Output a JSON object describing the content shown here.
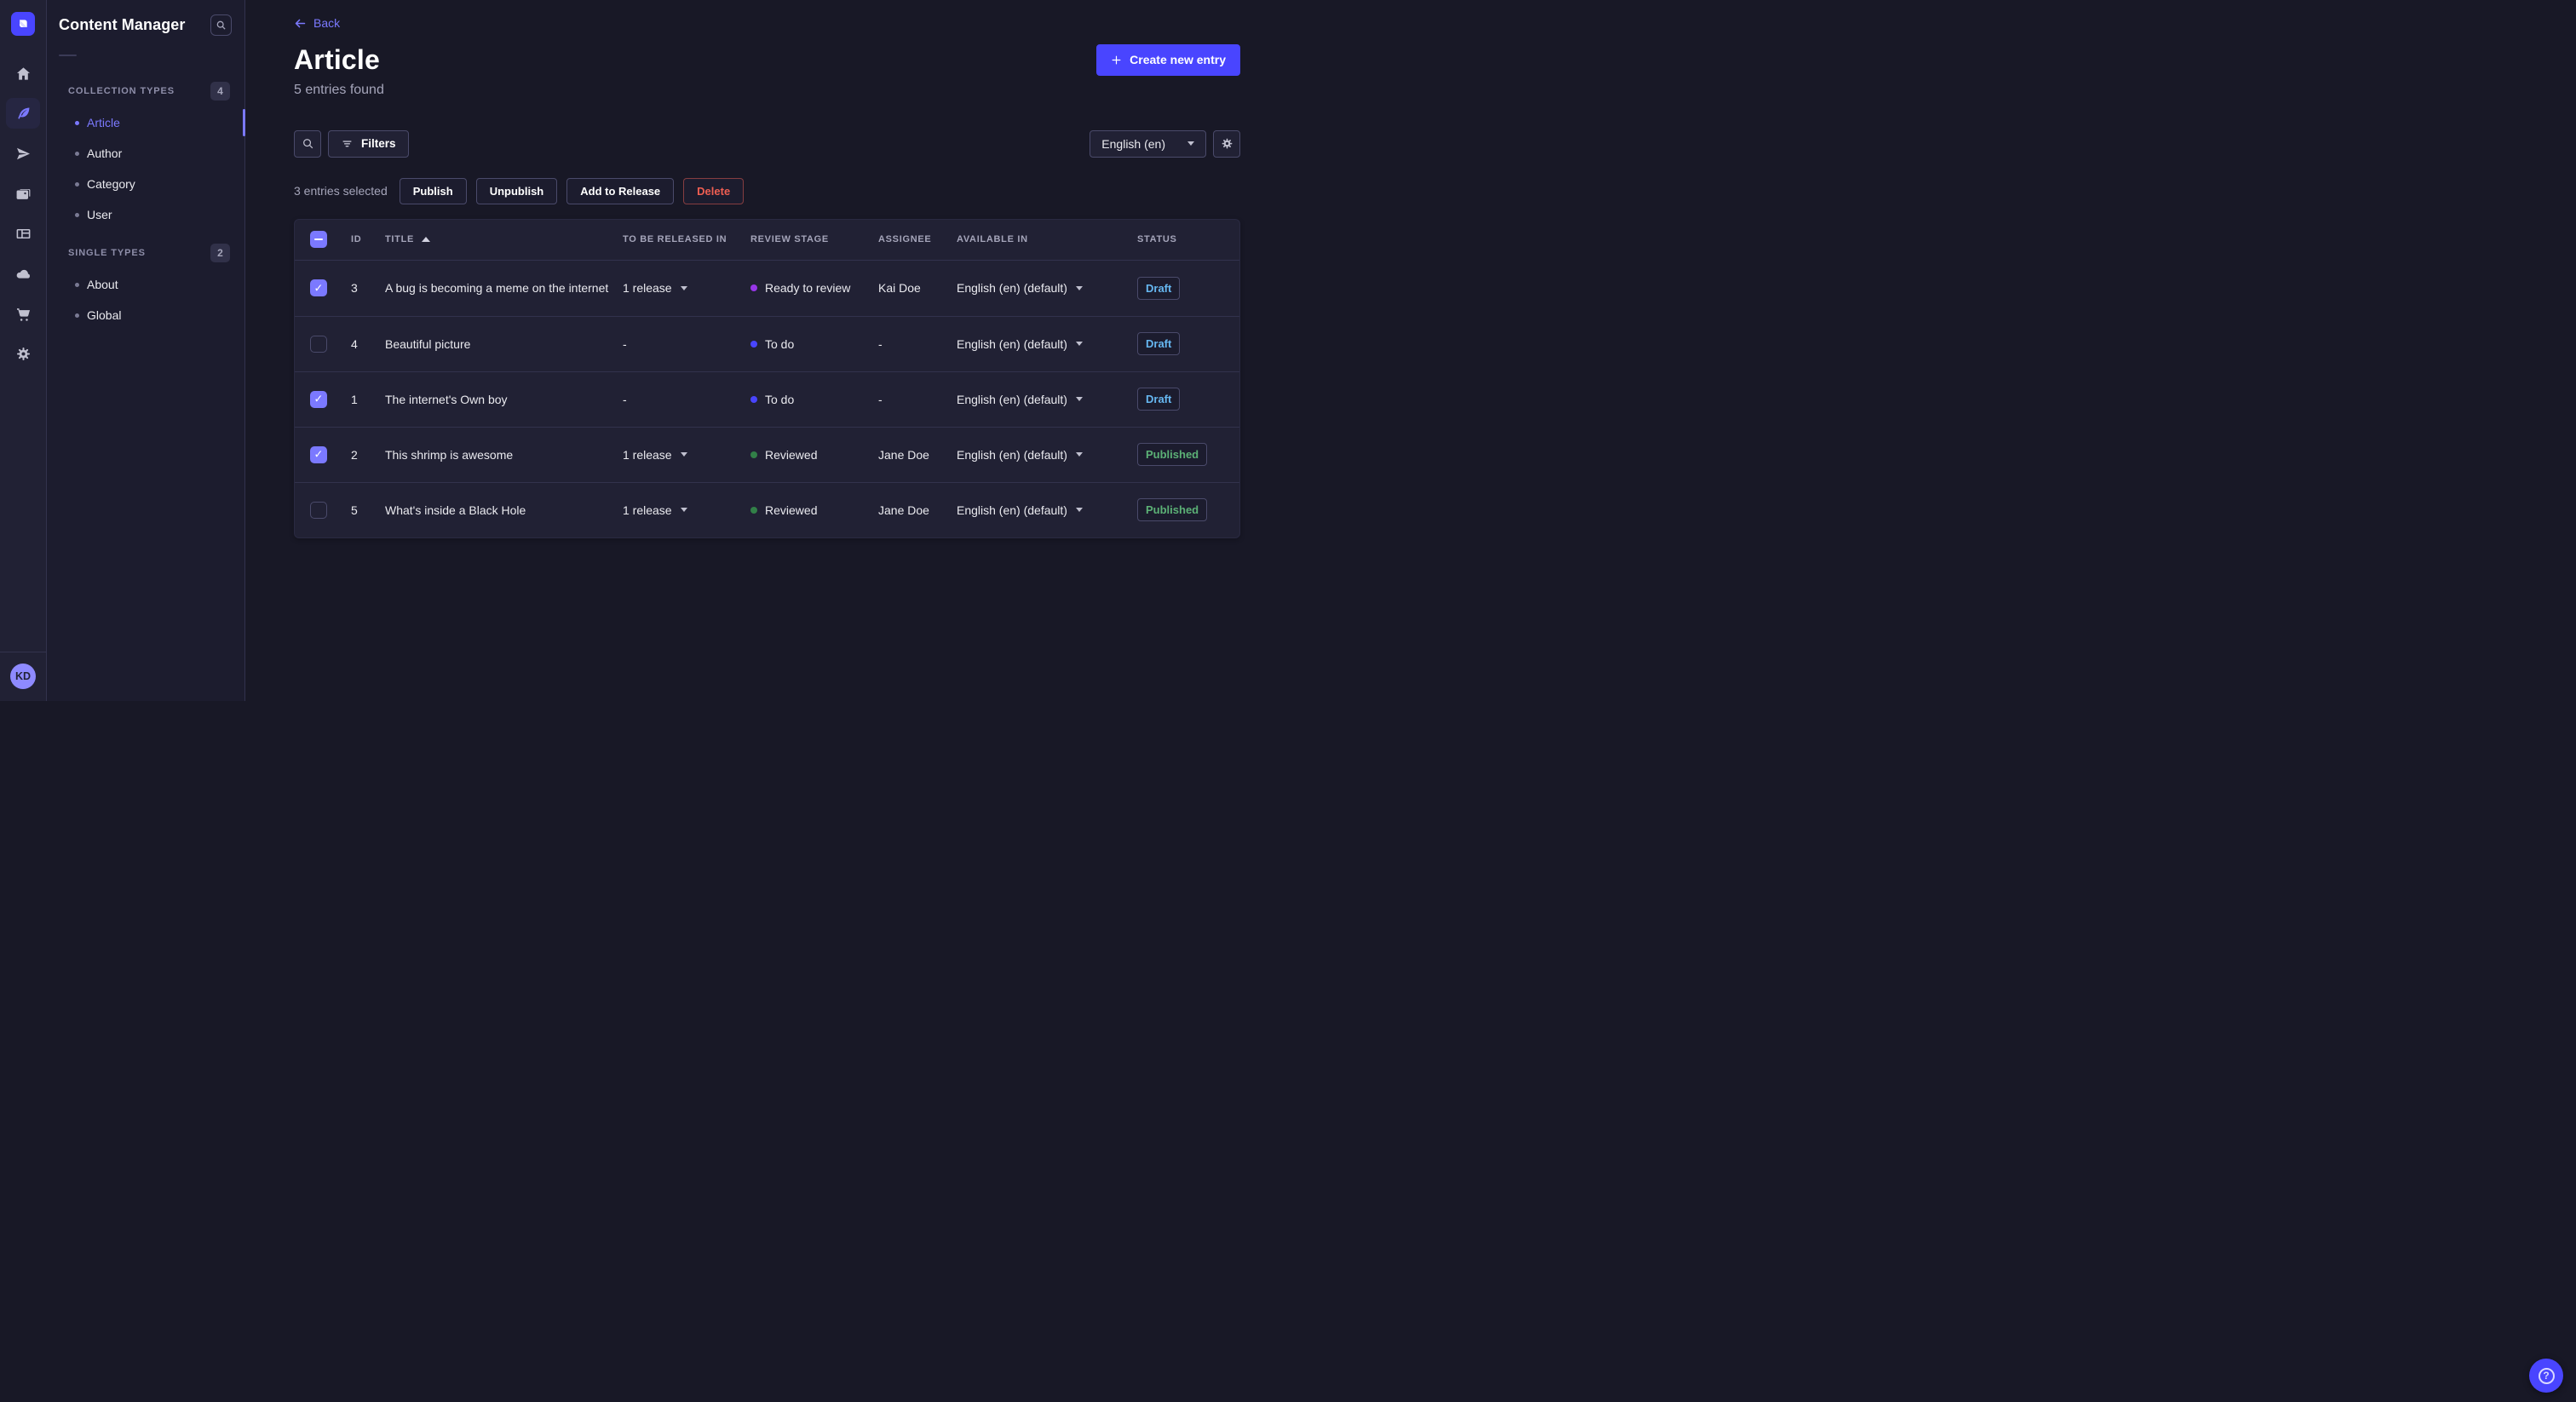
{
  "colors": {
    "bg": "#181826",
    "surface": "#212134",
    "surface_alt": "#1c1c2e",
    "border": "#32324d",
    "border_strong": "#4a4a6a",
    "text": "#ffffff",
    "text_muted": "#a5a5ba",
    "text_dim": "#8e8ea9",
    "accent": "#4945ff",
    "accent_light": "#7b79ff",
    "avatar_bg": "#8e8aff",
    "draft": "#66b7f1",
    "published": "#5cb176",
    "danger": "#ee5e52"
  },
  "nav_rail": {
    "items": [
      {
        "icon": "home-icon",
        "active": false
      },
      {
        "icon": "feather-icon",
        "active": true
      },
      {
        "icon": "paper-plane-icon",
        "active": false
      },
      {
        "icon": "media-images-icon",
        "active": false
      },
      {
        "icon": "layout-card-icon",
        "active": false
      },
      {
        "icon": "cloud-icon",
        "active": false
      },
      {
        "icon": "cart-icon",
        "active": false
      },
      {
        "icon": "gear-icon",
        "active": false
      }
    ],
    "avatar_initials": "KD"
  },
  "subsidebar": {
    "title": "Content Manager",
    "sections": [
      {
        "label": "COLLECTION TYPES",
        "count": "4",
        "items": [
          {
            "label": "Article",
            "active": true
          },
          {
            "label": "Author",
            "active": false
          },
          {
            "label": "Category",
            "active": false
          },
          {
            "label": "User",
            "active": false
          }
        ]
      },
      {
        "label": "SINGLE TYPES",
        "count": "2",
        "items": [
          {
            "label": "About",
            "active": false
          },
          {
            "label": "Global",
            "active": false
          }
        ]
      }
    ]
  },
  "header": {
    "back_label": "Back",
    "title": "Article",
    "subtitle": "5 entries found",
    "create_label": "Create new entry"
  },
  "toolbar": {
    "filters_label": "Filters",
    "locale_value": "English (en)"
  },
  "bulk_bar": {
    "selected_text": "3 entries selected",
    "actions": [
      "Publish",
      "Unpublish",
      "Add to Release",
      "Delete"
    ]
  },
  "table": {
    "columns": [
      "ID",
      "TITLE",
      "TO BE RELEASED IN",
      "REVIEW STAGE",
      "ASSIGNEE",
      "AVAILABLE IN",
      "STATUS"
    ],
    "sort_column": "TITLE",
    "sort_direction": "asc",
    "header_checkbox_state": "indeterminate",
    "status_colors": {
      "Draft": "#66b7f1",
      "Published": "#5cb176"
    },
    "rows": [
      {
        "checked": true,
        "id": "3",
        "title": "A bug is becoming a meme on the internet",
        "released_in": "1 release",
        "release_dropdown": true,
        "review_stage": "Ready to review",
        "review_color": "#9736e8",
        "assignee": "Kai Doe",
        "available_in": "English (en) (default)",
        "status": "Draft"
      },
      {
        "checked": false,
        "id": "4",
        "title": "Beautiful picture",
        "released_in": "-",
        "release_dropdown": false,
        "review_stage": "To do",
        "review_color": "#4945ff",
        "assignee": "-",
        "available_in": "English (en) (default)",
        "status": "Draft"
      },
      {
        "checked": true,
        "id": "1",
        "title": "The internet's Own boy",
        "released_in": "-",
        "release_dropdown": false,
        "review_stage": "To do",
        "review_color": "#4945ff",
        "assignee": "-",
        "available_in": "English (en) (default)",
        "status": "Draft"
      },
      {
        "checked": true,
        "id": "2",
        "title": "This shrimp is awesome",
        "released_in": "1 release",
        "release_dropdown": true,
        "review_stage": "Reviewed",
        "review_color": "#328048",
        "assignee": "Jane Doe",
        "available_in": "English (en) (default)",
        "status": "Published"
      },
      {
        "checked": false,
        "id": "5",
        "title": "What's inside a Black Hole",
        "released_in": "1 release",
        "release_dropdown": true,
        "review_stage": "Reviewed",
        "review_color": "#328048",
        "assignee": "Jane Doe",
        "available_in": "English (en) (default)",
        "status": "Published"
      }
    ]
  }
}
